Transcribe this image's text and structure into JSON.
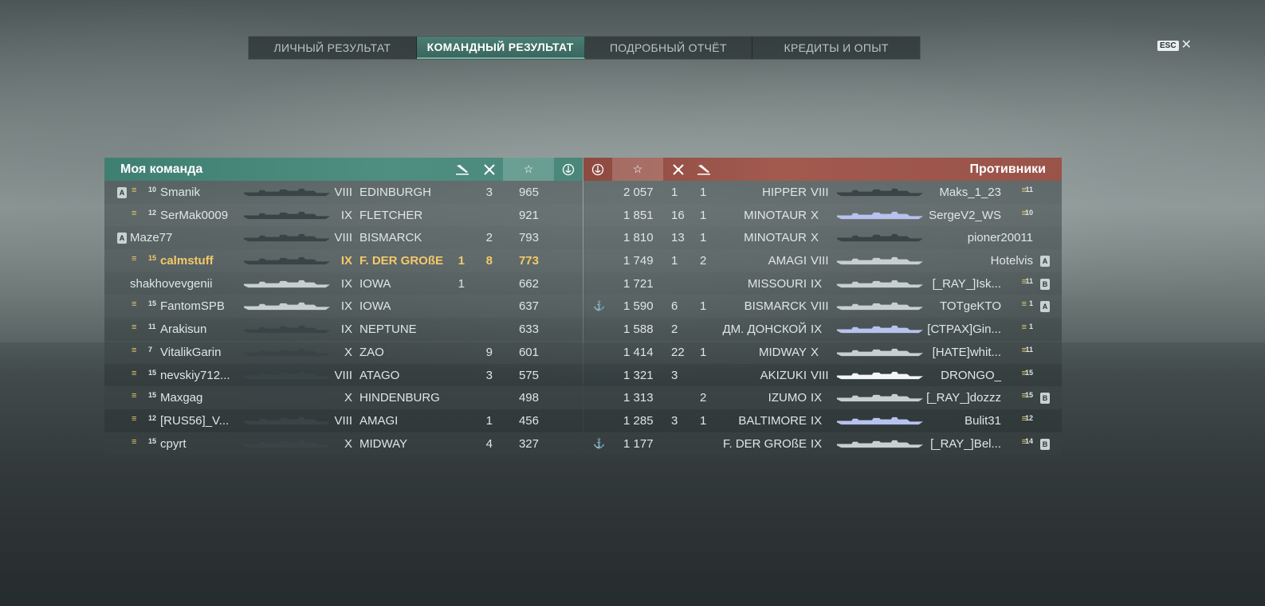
{
  "tabs": [
    {
      "label": "ЛИЧНЫЙ РЕЗУЛЬТАТ",
      "active": false
    },
    {
      "label": "КОМАНДНЫЙ РЕЗУЛЬТАТ",
      "active": true
    },
    {
      "label": "ПОДРОБНЫЙ ОТЧЁТ",
      "active": false
    },
    {
      "label": "КРЕДИТЫ И ОПЫТ",
      "active": false
    }
  ],
  "esc": {
    "key": "ESC",
    "close": "✕"
  },
  "my_team": {
    "title": "Моя команда",
    "rows": [
      {
        "badge": "A",
        "rank": "10",
        "name": "Smanik",
        "tier": "VIII",
        "ship": "EDINBURGH",
        "k1": "",
        "k2": "3",
        "score": "965",
        "silhouette": "dark"
      },
      {
        "badge": "",
        "rank": "12",
        "name": "SerMak0009",
        "tier": "IX",
        "ship": "FLETCHER",
        "k1": "",
        "k2": "",
        "score": "921",
        "silhouette": "dark"
      },
      {
        "badge": "A",
        "rank": "",
        "name": "Maze77",
        "tier": "VIII",
        "ship": "BISMARCK",
        "k1": "",
        "k2": "2",
        "score": "793",
        "silhouette": "dark"
      },
      {
        "badge": "",
        "rank": "15",
        "name": "calmstuff",
        "tier": "IX",
        "ship": "F. DER GROßE",
        "k1": "1",
        "k2": "8",
        "score": "773",
        "silhouette": "dark",
        "me": true
      },
      {
        "badge": "",
        "rank": "",
        "name": "shakhovevgenii",
        "tier": "IX",
        "ship": "IOWA",
        "k1": "1",
        "k2": "",
        "score": "662",
        "silhouette": "light"
      },
      {
        "badge": "",
        "rank": "15",
        "name": "FantomSPB",
        "tier": "IX",
        "ship": "IOWA",
        "k1": "",
        "k2": "",
        "score": "637",
        "silhouette": "light"
      },
      {
        "badge": "",
        "rank": "11",
        "name": "Arakisun",
        "tier": "IX",
        "ship": "NEPTUNE",
        "k1": "",
        "k2": "",
        "score": "633",
        "silhouette": "dark"
      },
      {
        "badge": "",
        "rank": "7",
        "name": "VitalikGarin",
        "tier": "X",
        "ship": "ZAO",
        "k1": "",
        "k2": "9",
        "score": "601",
        "silhouette": "dark"
      },
      {
        "badge": "",
        "rank": "15",
        "name": "nevskiy712...",
        "tier": "VIII",
        "ship": "ATAGO",
        "k1": "",
        "k2": "3",
        "score": "575",
        "silhouette": "dark"
      },
      {
        "badge": "",
        "rank": "15",
        "name": "Maxgag",
        "tier": "X",
        "ship": "HINDENBURG",
        "k1": "",
        "k2": "",
        "score": "498",
        "silhouette": "dark"
      },
      {
        "badge": "",
        "rank": "12",
        "name": "[RUS56]_V...",
        "tier": "VIII",
        "ship": "AMAGI",
        "k1": "",
        "k2": "1",
        "score": "456",
        "silhouette": "dark"
      },
      {
        "badge": "",
        "rank": "15",
        "name": "cpyrt",
        "tier": "X",
        "ship": "MIDWAY",
        "k1": "",
        "k2": "4",
        "score": "327",
        "silhouette": "dark"
      }
    ]
  },
  "enemy_team": {
    "title": "Противники",
    "rows": [
      {
        "medal": false,
        "score": "2 057",
        "k1": "1",
        "k2": "1",
        "ship": "HIPPER",
        "tier": "VIII",
        "name": "Maks_1_23",
        "rank": "11",
        "badge": "",
        "silhouette": "dark"
      },
      {
        "medal": false,
        "score": "1 851",
        "k1": "16",
        "k2": "1",
        "ship": "MINOTAUR",
        "tier": "X",
        "name": "SergeV2_WS",
        "rank": "10",
        "badge": "",
        "silhouette": "blue"
      },
      {
        "medal": false,
        "score": "1 810",
        "k1": "13",
        "k2": "1",
        "ship": "MINOTAUR",
        "tier": "X",
        "name": "pioner20011",
        "rank": "",
        "badge": "",
        "silhouette": "dark"
      },
      {
        "medal": false,
        "score": "1 749",
        "k1": "1",
        "k2": "2",
        "ship": "AMAGI",
        "tier": "VIII",
        "name": "Hotelvis",
        "rank": "",
        "badge": "A",
        "silhouette": "light"
      },
      {
        "medal": false,
        "score": "1 721",
        "k1": "",
        "k2": "",
        "ship": "MISSOURI",
        "tier": "IX",
        "name": "[_RAY_]Isk...",
        "rank": "11",
        "badge": "B",
        "silhouette": "light"
      },
      {
        "medal": true,
        "score": "1 590",
        "k1": "6",
        "k2": "1",
        "ship": "BISMARCK",
        "tier": "VIII",
        "name": "TOTgeKTO",
        "rank": "1",
        "badge": "A",
        "silhouette": "light"
      },
      {
        "medal": false,
        "score": "1 588",
        "k1": "2",
        "k2": "",
        "ship": "ДМ. ДОНСКОЙ",
        "tier": "IX",
        "name": "[СТРАХ]Gin...",
        "rank": "1",
        "badge": "",
        "silhouette": "blue"
      },
      {
        "medal": false,
        "score": "1 414",
        "k1": "22",
        "k2": "1",
        "ship": "MIDWAY",
        "tier": "X",
        "name": "[HATE]whit...",
        "rank": "11",
        "badge": "",
        "silhouette": "light"
      },
      {
        "medal": false,
        "score": "1 321",
        "k1": "3",
        "k2": "",
        "ship": "AKIZUKI",
        "tier": "VIII",
        "name": "DRONGO_",
        "rank": "15",
        "badge": "",
        "silhouette": "white"
      },
      {
        "medal": false,
        "score": "1 313",
        "k1": "",
        "k2": "2",
        "ship": "IZUMO",
        "tier": "IX",
        "name": "[_RAY_]dozzz",
        "rank": "15",
        "badge": "B",
        "silhouette": "light"
      },
      {
        "medal": false,
        "score": "1 285",
        "k1": "3",
        "k2": "1",
        "ship": "BALTIMORE",
        "tier": "IX",
        "name": "Bulit31",
        "rank": "12",
        "badge": "",
        "silhouette": "blue"
      },
      {
        "medal": true,
        "score": "1 177",
        "k1": "",
        "k2": "",
        "ship": "F. DER GROßE",
        "tier": "IX",
        "name": "[_RAY_]Bel...",
        "rank": "14",
        "badge": "B",
        "silhouette": "light"
      }
    ]
  },
  "colors": {
    "my_team": "#4a877a",
    "enemy": "#9a5349",
    "self_player": "#f4c96b"
  }
}
